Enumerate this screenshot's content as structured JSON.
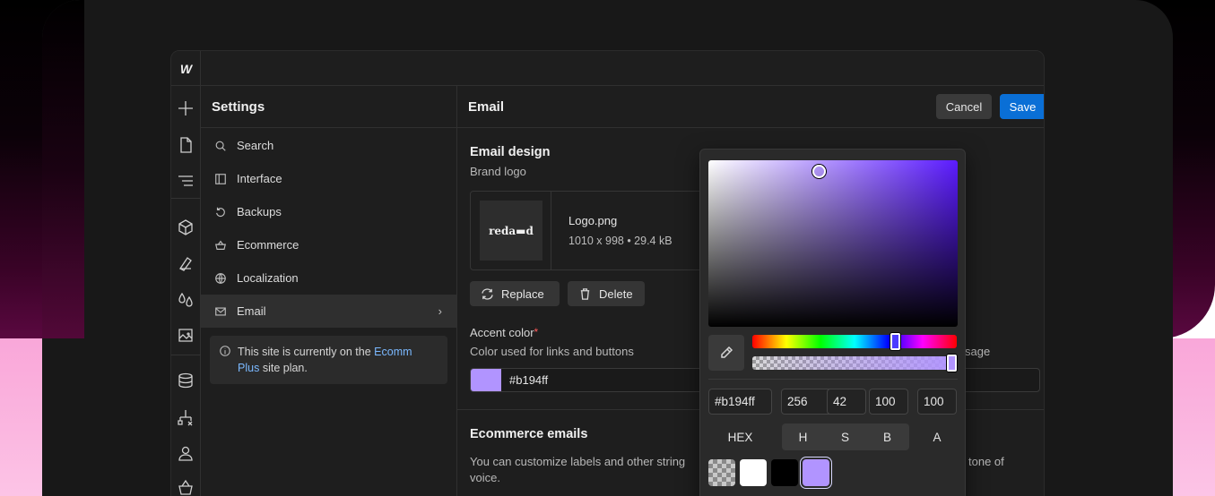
{
  "app": {
    "logo": "W",
    "rail_icons": [
      "plus-icon",
      "page-icon",
      "navigator-icon",
      "components-icon",
      "style-manager-icon",
      "variables-icon",
      "assets-icon",
      "cms-icon",
      "logic-icon",
      "users-icon",
      "ecommerce-icon"
    ]
  },
  "settings": {
    "title": "Settings",
    "items": [
      {
        "label": "Search",
        "icon": "search-icon"
      },
      {
        "label": "Interface",
        "icon": "interface-icon"
      },
      {
        "label": "Backups",
        "icon": "backup-icon"
      },
      {
        "label": "Ecommerce",
        "icon": "basket-icon"
      },
      {
        "label": "Localization",
        "icon": "globe-icon"
      },
      {
        "label": "Email",
        "icon": "mail-icon",
        "active": true
      }
    ],
    "chevron": "›",
    "info": {
      "prefix": "This site is currently on the",
      "plan_link_1": "Ecomm",
      "plan_link_2": "Plus",
      "suffix": "site plan."
    }
  },
  "email": {
    "title": "Email",
    "cancel_label": "Cancel",
    "save_label": "Save",
    "design_title": "Email design",
    "brand_logo_label": "Brand logo",
    "logo_thumb_text": "reda▬d",
    "file_name": "Logo.png",
    "file_meta": "1010 x 998 • 29.4 kB",
    "replace_label": "Replace",
    "delete_label": "Delete",
    "accent_label": "Accent color",
    "required_mark": "*",
    "accent_help": "Color used for links and buttons",
    "message_fragment": "sage",
    "accent_value": "#b194ff",
    "ecommerce_title": "Ecommerce emails",
    "ecommerce_desc_left": "You can customize labels and other string",
    "ecommerce_desc_right": "tone of",
    "ecommerce_desc_line2": "voice."
  },
  "picker": {
    "hex_value": "#b194ff",
    "h_value": "256",
    "s_value": "42",
    "b_value": "100",
    "a_value": "100",
    "hue_fraction": 0.71,
    "alpha_fraction": 1.0,
    "modes": {
      "hex": "HEX",
      "h": "H",
      "s": "S",
      "b": "B",
      "a": "A"
    },
    "swatches": [
      "transparent",
      "#ffffff",
      "#000000",
      "#b194ff"
    ],
    "colors": {
      "accent": "#b194ff",
      "save_button": "#0a6fd6"
    }
  }
}
